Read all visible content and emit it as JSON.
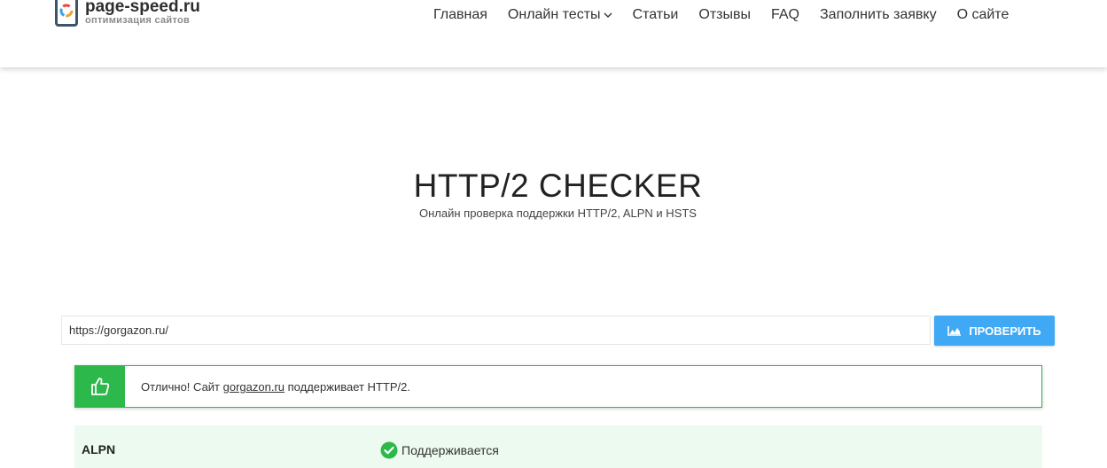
{
  "header": {
    "logo_name": "page-speed.ru",
    "logo_tagline": "оптимизация сайтов",
    "nav": [
      {
        "label": "Главная"
      },
      {
        "label": "Онлайн тесты"
      },
      {
        "label": "Статьи"
      },
      {
        "label": "Отзывы"
      },
      {
        "label": "FAQ"
      },
      {
        "label": "Заполнить заявку"
      },
      {
        "label": "О сайте"
      }
    ]
  },
  "hero": {
    "title": "HTTP/2 CHECKER",
    "subtitle": "Онлайн проверка поддержки HTTP/2, ALPN и HSTS"
  },
  "form": {
    "url_value": "https://gorgazon.ru/",
    "submit_label": "ПРОВЕРИТЬ"
  },
  "alert": {
    "prefix": "Отлично! Сайт ",
    "domain": "gorgazon.ru",
    "suffix": " поддерживает HTTP/2."
  },
  "results": [
    {
      "label": "ALPN",
      "value": "Поддерживается"
    }
  ],
  "colors": {
    "accent_blue": "#3fa9f5",
    "success_green": "#2cb84b",
    "row_bg": "#edfaef"
  }
}
